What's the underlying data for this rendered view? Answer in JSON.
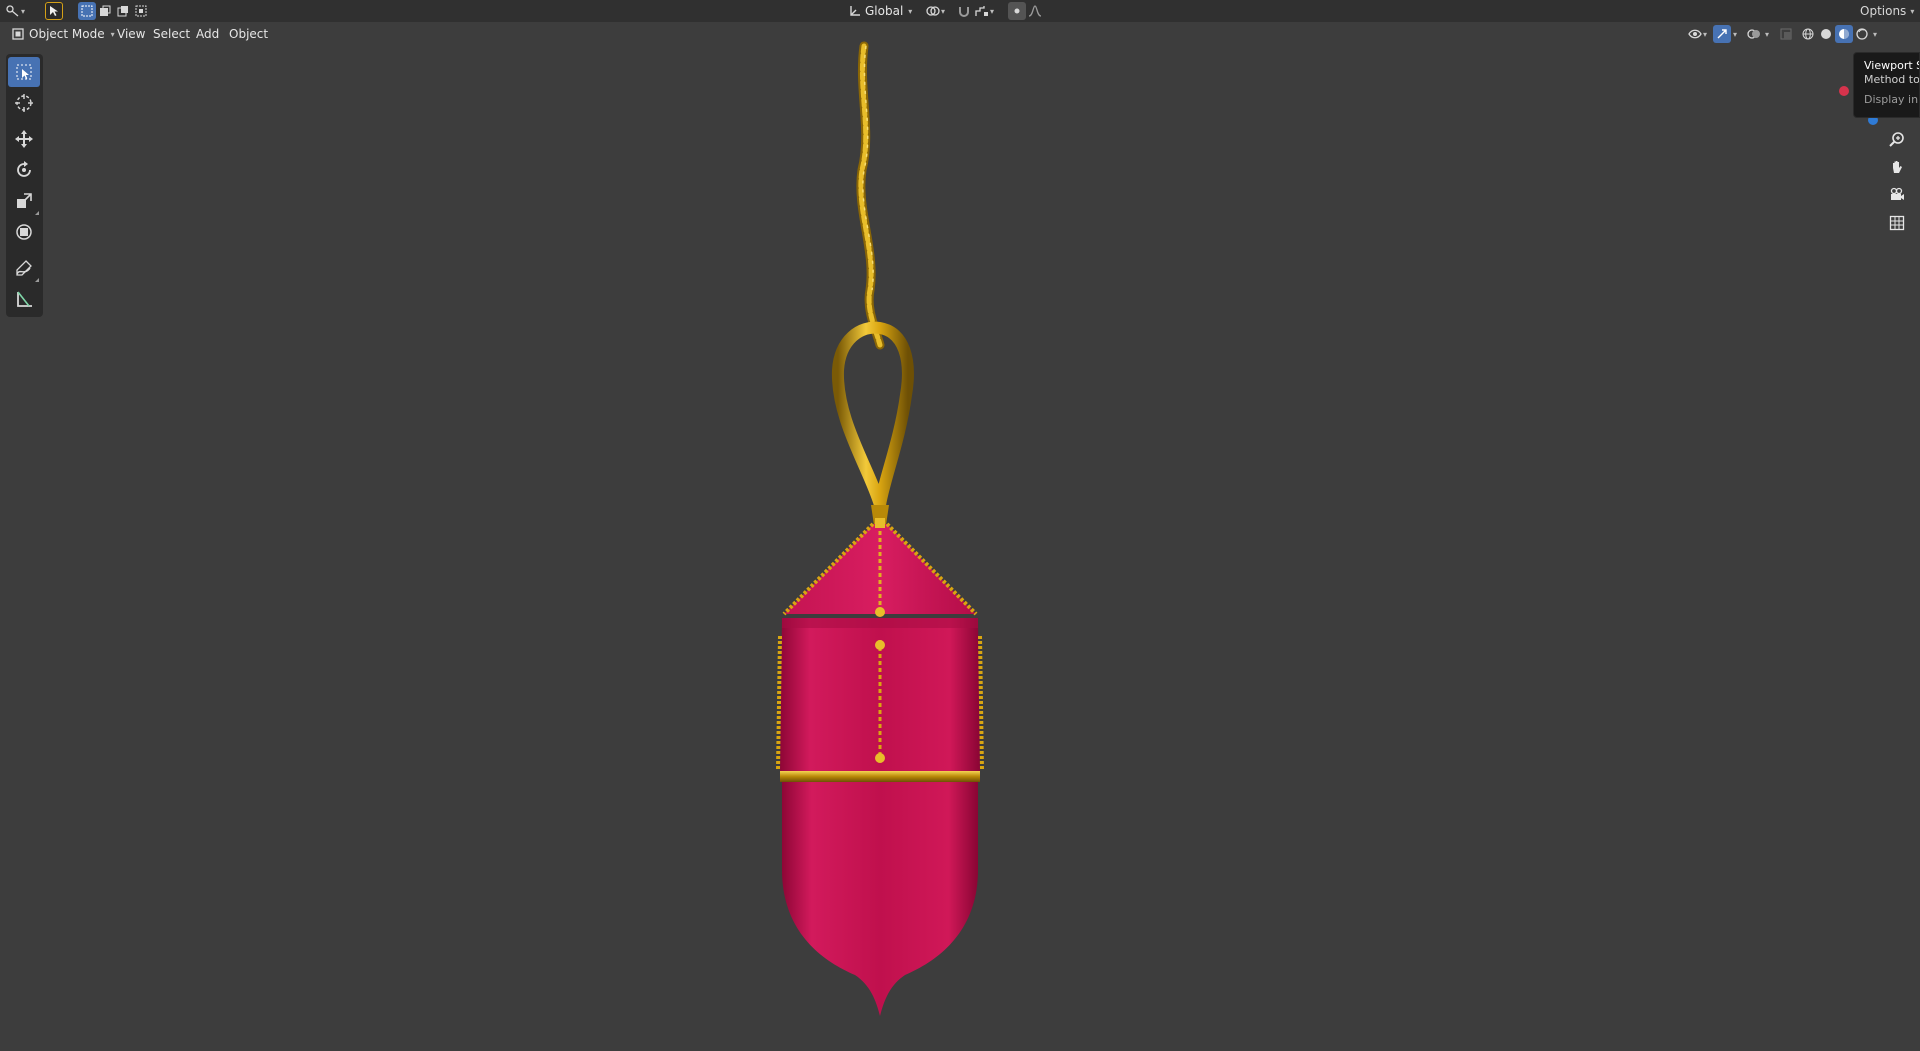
{
  "header": {
    "orientation_label": "Global",
    "options_label": "Options"
  },
  "menu": {
    "mode_label": "Object Mode",
    "view_label": "View",
    "select_label": "Select",
    "add_label": "Add",
    "object_label": "Object"
  },
  "tooltip": {
    "title": "Viewport Sh",
    "description": "Method to d",
    "python": "Display in M"
  },
  "colors": {
    "viewport_bg": "#3d3d3d",
    "header_bg": "#303030",
    "active_blue": "#4772b3",
    "lantern_body": "#c8104f",
    "gold": "#d4a017",
    "axis_x": "#d6334c",
    "axis_z": "#2f7bd6"
  },
  "icons": {
    "editor_type": "editor-type-icon",
    "select_tool": "select-box-icon",
    "cursor": "cursor-icon",
    "move": "move-icon",
    "rotate": "rotate-icon",
    "scale": "scale-icon",
    "transform": "transform-icon",
    "annotate": "annotate-icon",
    "measure": "measure-icon",
    "zoom": "zoom-icon",
    "pan": "hand-icon",
    "camera": "camera-icon",
    "ortho": "grid-icon"
  }
}
